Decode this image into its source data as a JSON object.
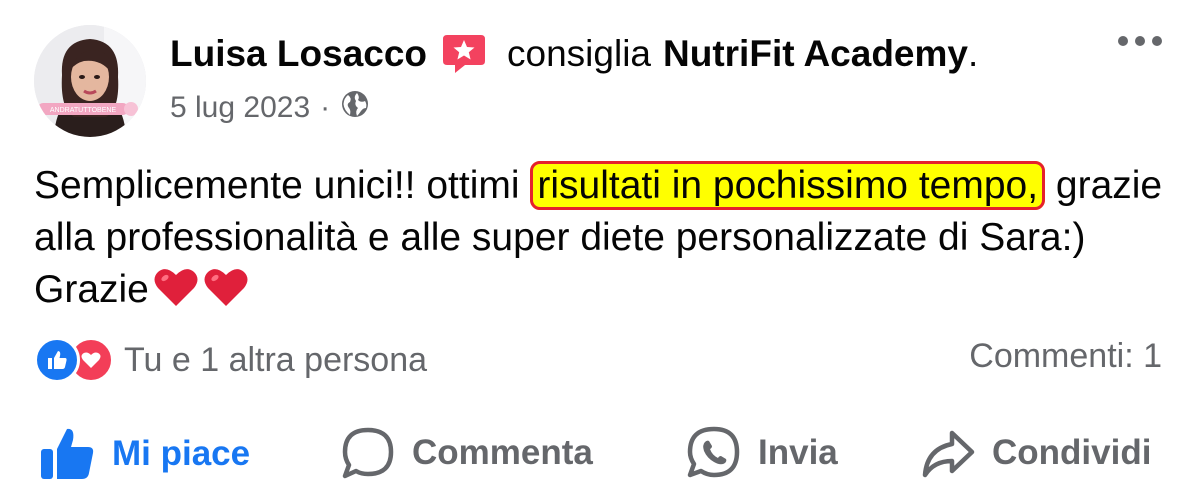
{
  "post": {
    "author": "Luisa Losacco",
    "verb": "consiglia",
    "page_name": "NutriFit Academy",
    "page_suffix": ".",
    "date": "5 lug 2023",
    "separator": "·",
    "privacy_icon": "globe-icon",
    "avatar_caption": "ANDRATUTTOBENE",
    "text_before": "Semplicemente unici!! ottimi ",
    "text_highlight": "risultati in pochissimo tempo,",
    "text_after": " grazie alla professionalità e alle super diete personalizzate di Sara:) Grazie",
    "emojis": [
      "heart",
      "heart"
    ]
  },
  "stats": {
    "reactions_text": "Tu e 1 altra persona",
    "comments_text": "Commenti: 1",
    "reaction_icons": [
      "like-icon",
      "love-icon"
    ]
  },
  "actions": {
    "like": "Mi piace",
    "comment": "Commenta",
    "send": "Invia",
    "share": "Condividi"
  },
  "colors": {
    "brand_blue": "#1877f2",
    "love_red": "#f33e58",
    "highlight_yellow": "#ffff00",
    "highlight_border": "#e5202d",
    "secondary_text": "#65676b"
  }
}
